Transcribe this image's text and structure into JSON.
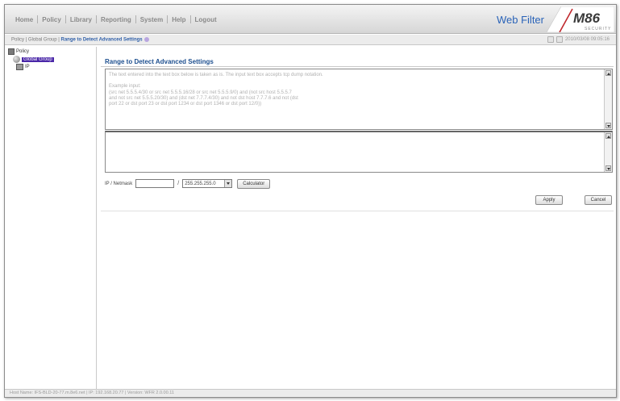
{
  "nav": {
    "items": [
      "Home",
      "Policy",
      "Library",
      "Reporting",
      "System",
      "Help",
      "Logout"
    ]
  },
  "brand": {
    "product": "Web Filter",
    "logo_main": "M86",
    "logo_sub": "SECURITY",
    "accent": "#2a63b8",
    "logo_red": "#c0282d"
  },
  "breadcrumb": {
    "path": "Policy | Global Group | ",
    "current": "Range to Detect Advanced Settings",
    "timestamp": "2010/03/08 09:05:16"
  },
  "tree": {
    "root": "Policy",
    "selected": "Global Group",
    "child": "IP",
    "selected_color": "#4a27a8"
  },
  "main": {
    "title": "Range to Detect Advanced Settings",
    "help_text": "The text entered into the text box below is taken as is. The input text box accepts tcp dump notation.\n\nExample input:\n(src net 5.5.5.4/30 or src net 5.5.5.16/28 or src net 5.5.5.9/0) and (not src host 5.5.5.7\nand not src net 5.5.5.20/30) and (dst net 7.7.7.4/30) and not dst host 7.7.7.6 and not (dst\nport 22 or dst port 23 or dst port 1234 or dst port 1346 or dst port 12/0))",
    "ip_label": "IP / Netmask",
    "ip_value": "",
    "netmask_value": "255.255.255.0",
    "calculator_label": "Calculator",
    "apply_label": "Apply",
    "cancel_label": "Cancel"
  },
  "status": {
    "text": "Host Name: IFS-BLD-20-77.m.8e6.net  |  IP: 192.168.20.77  |  Version: WFR 2.0.00.11"
  }
}
